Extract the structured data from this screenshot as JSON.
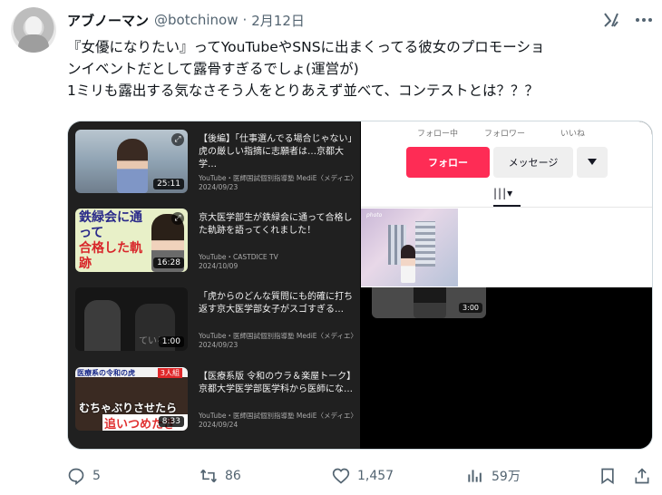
{
  "tweet": {
    "author_name": "アブノーマン",
    "handle": "@botchinow",
    "separator": "·",
    "date": "2月12日",
    "text": "『女優になりたい』ってYouTubeやSNSに出まくってる彼女のプロモーショ\nンイベントだとして露骨すぎるでしょ(運営が)\n1ミリも露出する気なさそう人をとりあえず並べて、コンテストとは？？？"
  },
  "youtube_list": [
    {
      "title": "【後編】「仕事選んでる場合じゃない」虎の厳しい指摘に志願者は…京都大学…",
      "channel": "YouTube・医師国試個別指導塾 MediE〈メディエ〉",
      "date": "2024/09/23",
      "duration": "25:11"
    },
    {
      "title": "京大医学部生が鉄緑会に通って合格した軌跡を語ってくれました！",
      "channel": "YouTube・CASTDICE TV",
      "date": "2024/10/09",
      "duration": "16:28",
      "thumb_text_1": "鉄緑会に通って",
      "thumb_text_2": "合格した軌跡"
    },
    {
      "title": "「虎からのどんな質問にも的確に打ち返す京大医学部女子がスゴすぎる…",
      "channel": "YouTube・医師国試個別指導塾 MediE〈メディエ〉",
      "date": "2024/09/23",
      "duration": "1:00",
      "thumb_text_1": "ている"
    },
    {
      "title": "【医療系版 令和のウラ＆楽屋トーク】京都大学医学部医学科から医師にな…",
      "channel": "YouTube・医師国試個別指導塾 MediE〈メディエ〉",
      "date": "2024/09/24",
      "duration": "8:33",
      "thumb_text_1": "医療系の令和の虎",
      "thumb_text_2": "3人組",
      "thumb_text_3": "むちゃぶりさせたら",
      "thumb_text_4": "追いつめたきます"
    }
  ],
  "tiktok": {
    "stats_labels": [
      "フォロー中",
      "フォロワー",
      "いいね"
    ],
    "follow_label": "フォロー",
    "message_label": "メッセージ",
    "grid_caption": "photo",
    "video_duration": "3:00"
  },
  "actions": {
    "replies": "5",
    "reposts": "86",
    "likes": "1,457",
    "views": "59万"
  },
  "colors": {
    "text": "#0f1419",
    "muted": "#536471",
    "tiktok_accent": "#fe2c55"
  }
}
